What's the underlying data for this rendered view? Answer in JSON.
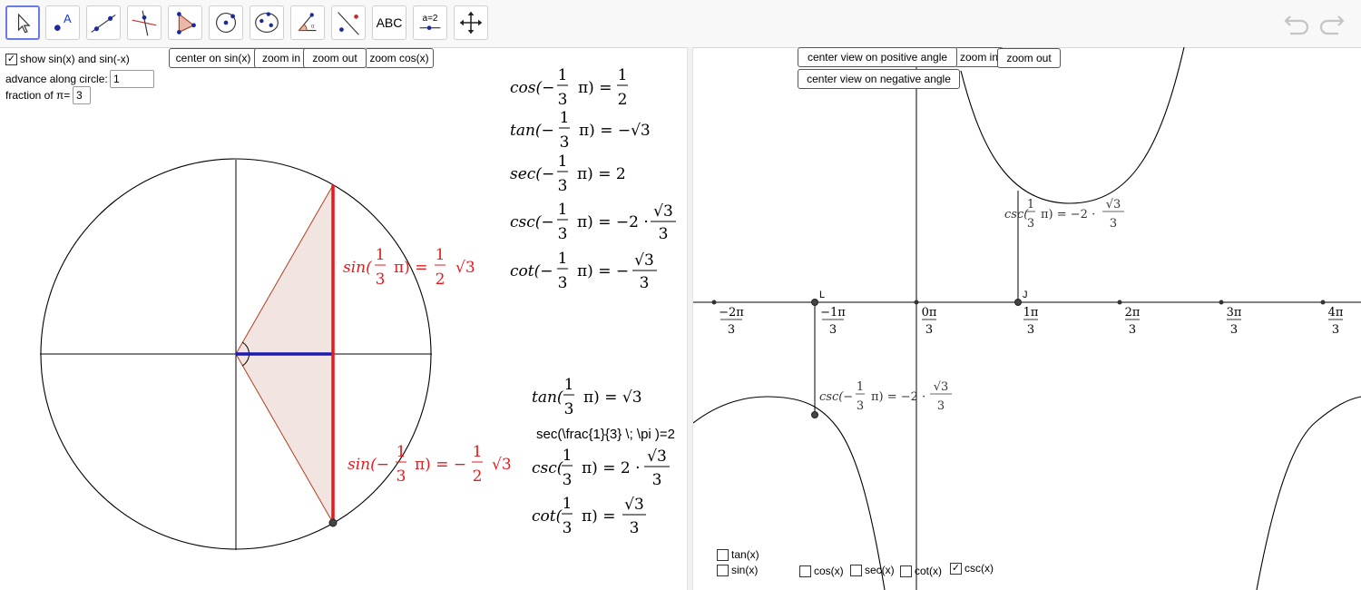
{
  "toolbar": {
    "tools": [
      {
        "name": "move-tool",
        "label": ""
      },
      {
        "name": "point-tool",
        "label": "A"
      },
      {
        "name": "line-tool",
        "label": ""
      },
      {
        "name": "perpendicular-line-tool",
        "label": ""
      },
      {
        "name": "polygon-tool",
        "label": ""
      },
      {
        "name": "circle-tool",
        "label": ""
      },
      {
        "name": "ellipse-tool",
        "label": ""
      },
      {
        "name": "angle-tool",
        "label": ""
      },
      {
        "name": "reflect-tool",
        "label": ""
      },
      {
        "name": "text-tool",
        "label": "ABC"
      },
      {
        "name": "slider-tool",
        "label": "a=2"
      },
      {
        "name": "move-graphics-tool",
        "label": ""
      }
    ]
  },
  "left": {
    "show_sin_label": "show sin(x) and sin(-x)",
    "advance_label": "advance along circle:",
    "advance_value": "1",
    "fraction_label": "fraction of π=",
    "fraction_value": "3",
    "btn_center_sin": "center on sin(x)",
    "btn_zoom_in": "zoom in",
    "btn_zoom_out": "zoom out",
    "btn_zoom_cos": "zoom cos(x)",
    "sin_pos": {
      "fn": "sin(",
      "num": "1",
      "den": "3",
      "mid": "π) =",
      "rnum": "1",
      "rden": "2",
      "rad": "√3"
    },
    "sin_neg": {
      "fn": "sin(−",
      "num": "1",
      "den": "3",
      "mid": "π) = −",
      "rnum": "1",
      "rden": "2",
      "rad": "√3"
    },
    "eq_cos_neg": {
      "fn": "cos(−",
      "num": "1",
      "den": "3",
      "mid": "π) =",
      "rnum": "1",
      "rden": "2"
    },
    "eq_tan_neg": {
      "fn": "tan(−",
      "num": "1",
      "den": "3",
      "rhs": "π) = −√3"
    },
    "eq_sec_neg": {
      "fn": "sec(−",
      "num": "1",
      "den": "3",
      "rhs": "π) = 2"
    },
    "eq_csc_neg": {
      "fn": "csc(−",
      "num": "1",
      "den": "3",
      "mid": "π) = −2 ·",
      "rnum": "√3",
      "rden": "3"
    },
    "eq_cot_neg": {
      "fn": "cot(−",
      "num": "1",
      "den": "3",
      "mid": "π) = −",
      "rnum": "√3",
      "rden": "3"
    },
    "eq_tan_pos": {
      "fn": "tan(",
      "num": "1",
      "den": "3",
      "rhs": "π) = √3"
    },
    "eq_sec_raw": "sec(\\frac{1}{3} \\; \\pi )=2",
    "eq_csc_pos": {
      "fn": "csc(",
      "num": "1",
      "den": "3",
      "mid": "π) = 2 ·",
      "rnum": "√3",
      "rden": "3"
    },
    "eq_cot_pos": {
      "fn": "cot(",
      "num": "1",
      "den": "3",
      "mid": "π) =",
      "rnum": "√3",
      "rden": "3"
    }
  },
  "right": {
    "btn_center_pos": "center view on positive angle",
    "btn_center_neg": "center view on negative angle",
    "btn_zoom_in": "zoom in",
    "btn_zoom_out": "zoom out",
    "point_L": "L",
    "point_J": "J",
    "tick_labels": [
      {
        "num": "−2π",
        "den": "3"
      },
      {
        "num": "−1π",
        "den": "3"
      },
      {
        "num": "0π",
        "den": "3"
      },
      {
        "num": "1π",
        "den": "3"
      },
      {
        "num": "2π",
        "den": "3"
      },
      {
        "num": "3π",
        "den": "3"
      },
      {
        "num": "4π",
        "den": "3"
      }
    ],
    "csc_pos_label": {
      "fn": "csc(",
      "num": "1",
      "den": "3",
      "mid": "π) = −2 ·",
      "rnum": "√3",
      "rden": "3"
    },
    "csc_neg_label": {
      "fn": "csc(−",
      "num": "1",
      "den": "3",
      "mid": "π) = −2 ·",
      "rnum": "√3",
      "rden": "3"
    },
    "checkboxes": {
      "tan": {
        "label": "tan(x)",
        "checked": false
      },
      "sin": {
        "label": "sin(x)",
        "checked": false
      },
      "cos": {
        "label": "cos(x)",
        "checked": false
      },
      "sec": {
        "label": "sec(x)",
        "checked": false
      },
      "cot": {
        "label": "cot(x)",
        "checked": false
      },
      "csc": {
        "label": "csc(x)",
        "checked": true
      }
    }
  },
  "colors": {
    "red": "#e8191d",
    "blue": "#1a1ab0",
    "triangle_fill": "#f2e4e0",
    "triangle_stroke": "#b04020"
  },
  "check_mark": "✓"
}
